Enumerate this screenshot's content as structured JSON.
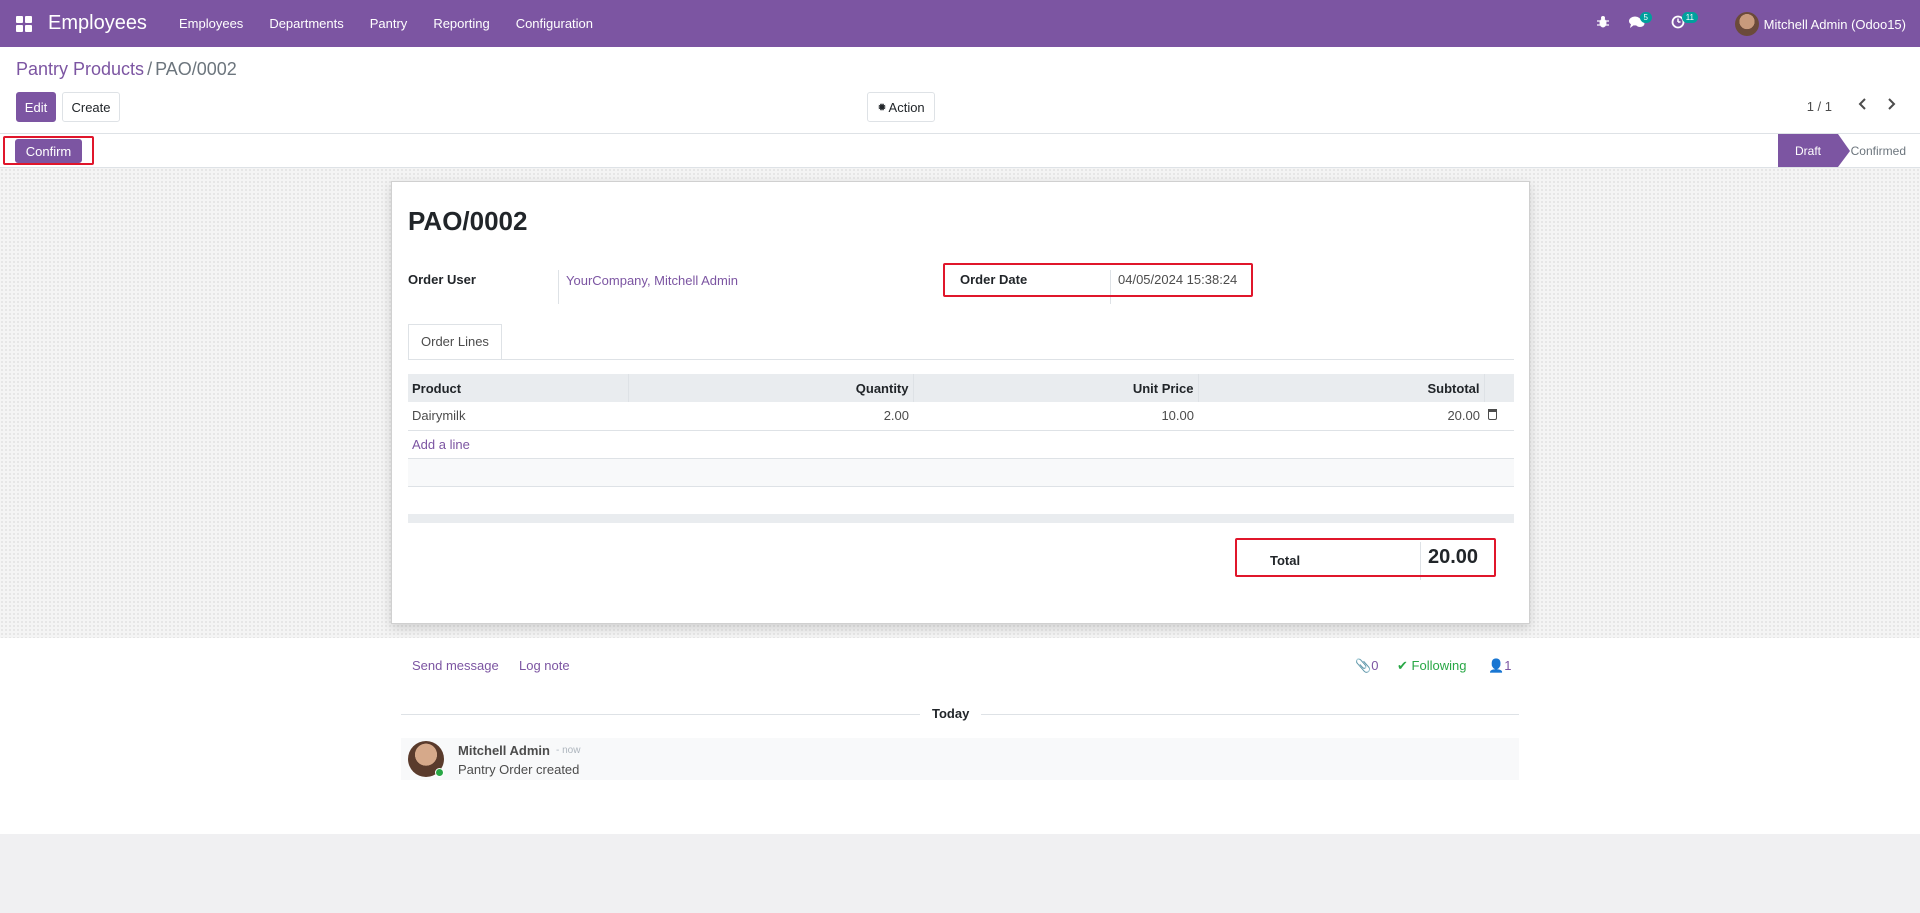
{
  "navbar": {
    "app_title": "Employees",
    "menu": [
      "Employees",
      "Departments",
      "Pantry",
      "Reporting",
      "Configuration"
    ],
    "chat_badge": "5",
    "activity_badge": "11",
    "user_name": "Mitchell Admin (Odoo15)"
  },
  "breadcrumb": {
    "parent": "Pantry Products",
    "separator": "/",
    "current": "PAO/0002"
  },
  "toolbar": {
    "edit_label": "Edit",
    "create_label": "Create",
    "action_label": "Action",
    "pager": "1 / 1"
  },
  "statusbar": {
    "confirm_label": "Confirm",
    "stages": [
      "Draft",
      "Confirmed"
    ],
    "active_stage": "Draft"
  },
  "form": {
    "title": "PAO/0002",
    "order_user_label": "Order User",
    "order_user_value": "YourCompany, Mitchell Admin",
    "order_date_label": "Order Date",
    "order_date_value": "04/05/2024 15:38:24",
    "tab_label": "Order Lines",
    "columns": [
      "Product",
      "Quantity",
      "Unit Price",
      "Subtotal"
    ],
    "lines": [
      {
        "product": "Dairymilk",
        "quantity": "2.00",
        "unit_price": "10.00",
        "subtotal": "20.00"
      }
    ],
    "add_line_label": "Add a line",
    "total_label": "Total",
    "total_value": "20.00"
  },
  "chatter": {
    "send_message": "Send message",
    "log_note": "Log note",
    "attachments": "0",
    "following": "Following",
    "followers": "1",
    "date_separator": "Today",
    "messages": [
      {
        "author": "Mitchell Admin",
        "time": "- now",
        "body": "Pantry Order created"
      }
    ]
  },
  "colors": {
    "brand": "#7c55a2",
    "highlight": "#e0162b",
    "following": "#28a745"
  }
}
